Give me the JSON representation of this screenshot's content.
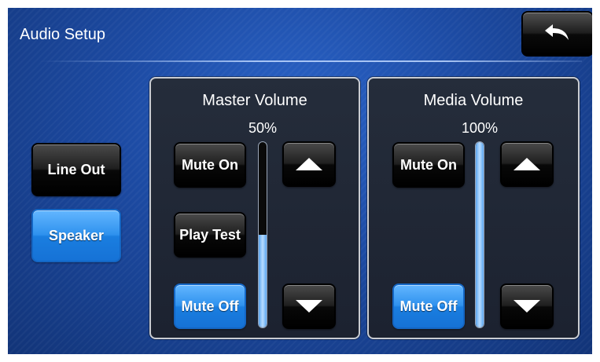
{
  "header": {
    "title": "Audio Setup",
    "back_icon": "back-arrow-icon"
  },
  "output": {
    "line_out_label": "Line Out",
    "speaker_label": "Speaker",
    "selected": "Speaker"
  },
  "master": {
    "title": "Master Volume",
    "percent_text": "50%",
    "level": 0.5,
    "mute_on_label": "Mute On",
    "play_test_label": "Play Test",
    "mute_off_label": "Mute Off",
    "mute_state": "Mute Off"
  },
  "media": {
    "title": "Media Volume",
    "percent_text": "100%",
    "level": 1.0,
    "mute_on_label": "Mute On",
    "mute_off_label": "Mute Off",
    "mute_state": "Mute Off"
  },
  "colors": {
    "active_button": "#2f92ee",
    "inactive_button": "#1f1f1f",
    "background": "#1c4aa2"
  }
}
